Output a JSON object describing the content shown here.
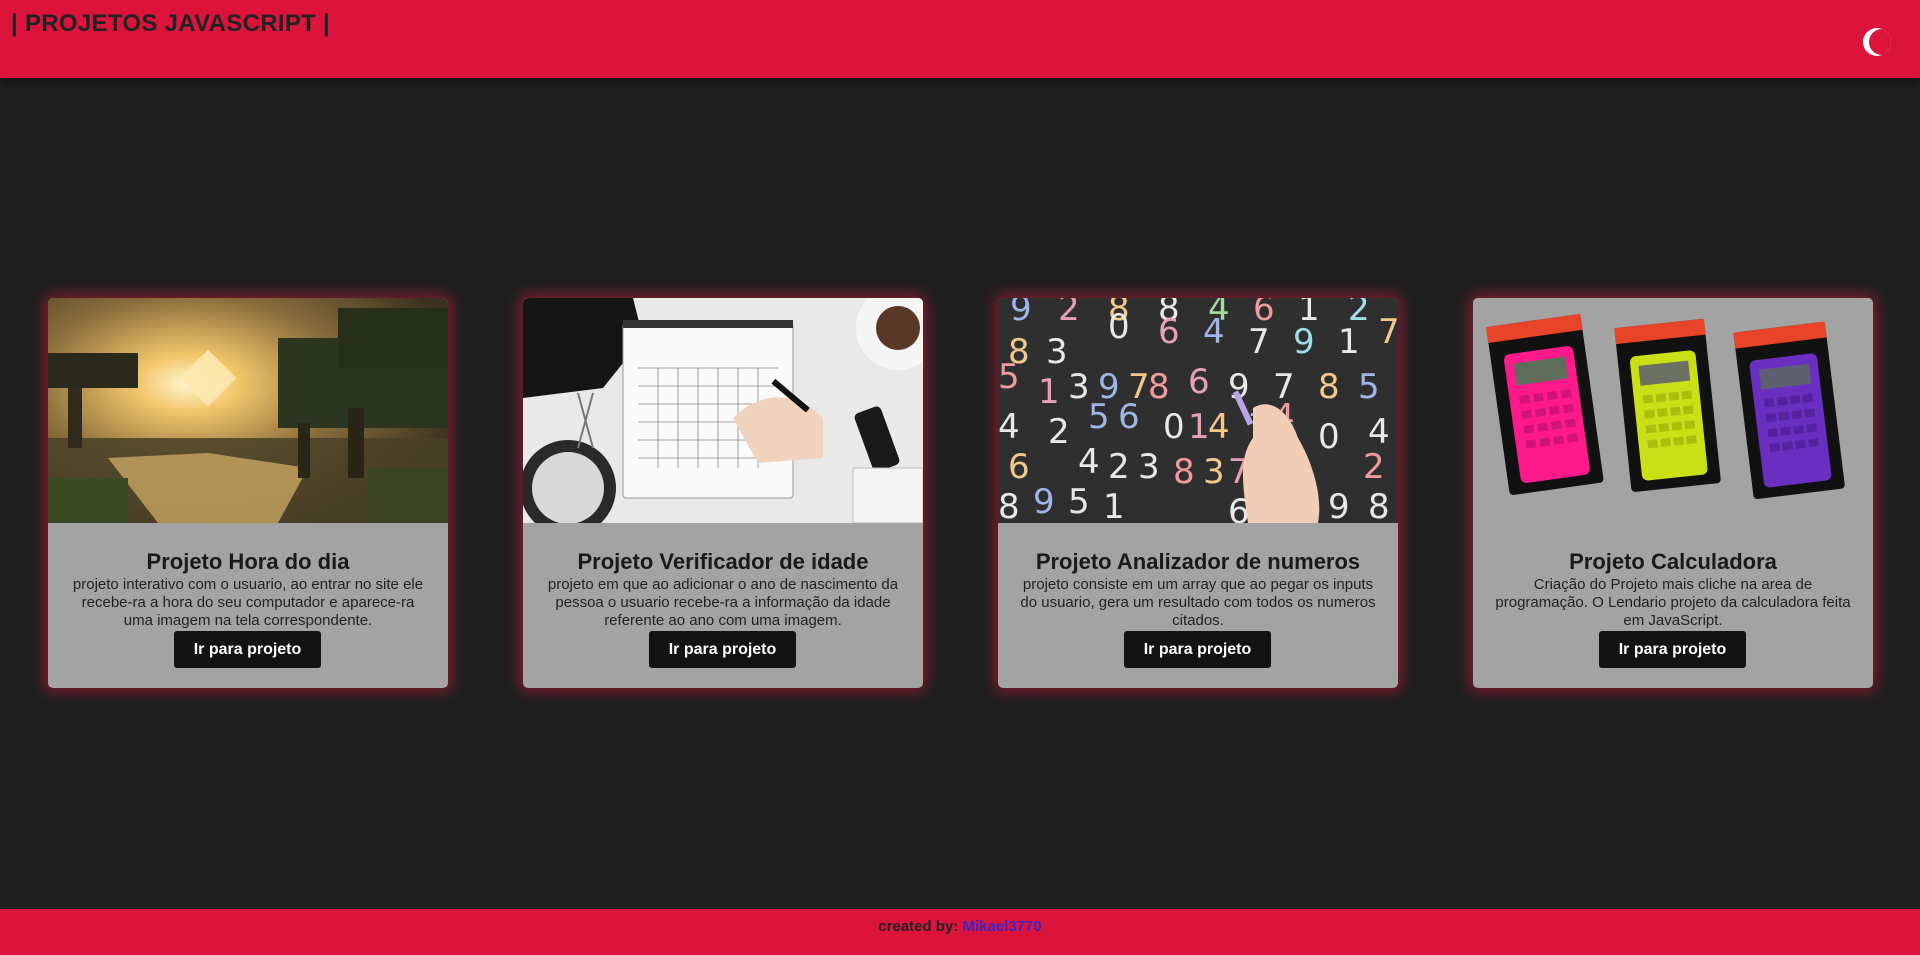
{
  "header": {
    "title": "| PROJETOS JAVASCRIPT |",
    "theme_toggle_icon": "crescent-moon-icon",
    "background_color": "#dc143c"
  },
  "page": {
    "background_color": "#202020"
  },
  "cards": [
    {
      "image": "minecraft-sunset-photo",
      "title": "Projeto Hora do dia",
      "description": "projeto interativo com o usuario, ao entrar no site ele recebe-ra a hora do seu computador e aparece-ra uma imagem na tela correspondente.",
      "button": "Ir para projeto"
    },
    {
      "image": "calendar-writing-photo",
      "title": "Projeto Verificador de idade",
      "description": "projeto em que ao adicionar o ano de nascimento da pessoa o usuario recebe-ra a informação da idade referente ao ano com uma imagem.",
      "button": "Ir para projeto"
    },
    {
      "image": "chalkboard-numbers-photo",
      "title": "Projeto Analizador de numeros",
      "description": "projeto consiste em um array que ao pegar os inputs do usuario, gera um resultado com todos os numeros citados.",
      "button": "Ir para projeto"
    },
    {
      "image": "calculators-photo",
      "title": "Projeto Calculadora",
      "description": "Criação do Projeto mais cliche na area de programação. O Lendario projeto da calculadora feita em JavaScript.",
      "button": "Ir para projeto"
    }
  ],
  "footer": {
    "prefix": "created by:",
    "author": "Mikael3770",
    "author_color": "#3b24c9"
  }
}
